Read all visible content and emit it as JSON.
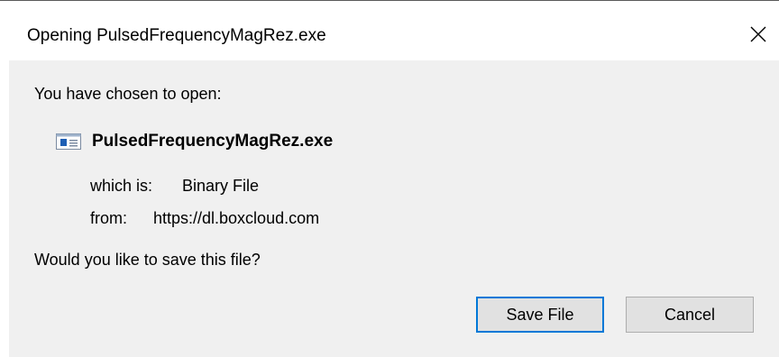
{
  "window": {
    "title": "Opening PulsedFrequencyMagRez.exe",
    "close_icon": "close-icon"
  },
  "body": {
    "intro": "You have chosen to open:",
    "file_icon": "executable-file-icon",
    "file_name": "PulsedFrequencyMagRez.exe",
    "type_label": "which is:",
    "type_value": "Binary File",
    "from_label": "from:",
    "from_value": "https://dl.boxcloud.com",
    "question": "Would you like to save this file?"
  },
  "buttons": {
    "save_label": "Save File",
    "cancel_label": "Cancel"
  },
  "colors": {
    "content_bg": "#f0f0f0",
    "button_bg": "#e1e1e1",
    "focus_border": "#0078d7",
    "icon_blue": "#1e5fb4"
  }
}
